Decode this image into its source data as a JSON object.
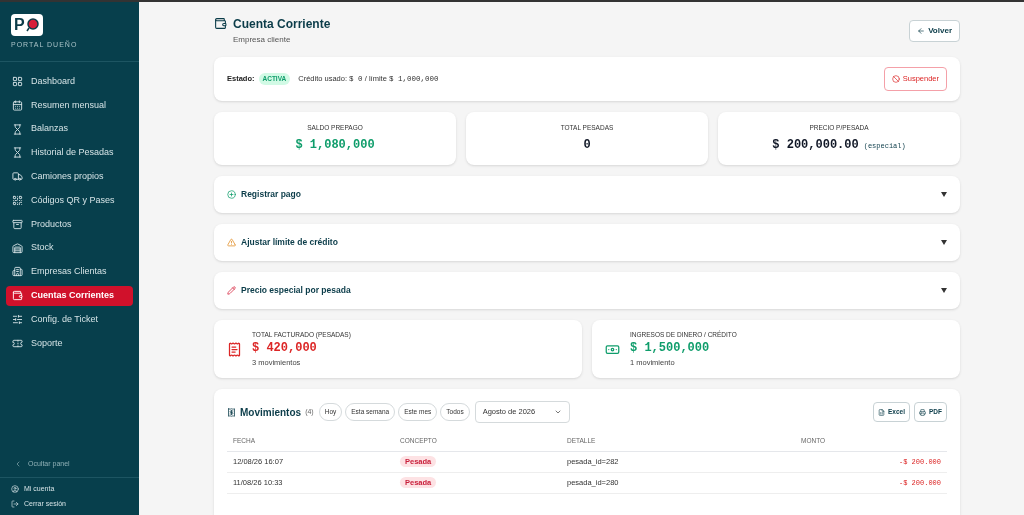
{
  "sidebar": {
    "logo_mark": "P",
    "logo_caption": "PORTAL DUEÑO",
    "items": [
      {
        "label": "Dashboard",
        "selected": false
      },
      {
        "label": "Resumen mensual",
        "selected": false
      },
      {
        "label": "Balanzas",
        "selected": false
      },
      {
        "label": "Historial de Pesadas",
        "selected": false
      },
      {
        "label": "Camiones propios",
        "selected": false
      },
      {
        "label": "Códigos QR y Pases",
        "selected": false
      },
      {
        "label": "Productos",
        "selected": false
      },
      {
        "label": "Stock",
        "selected": false
      },
      {
        "label": "Empresas Clientas",
        "selected": false
      },
      {
        "label": "Cuentas Corrientes",
        "selected": true
      },
      {
        "label": "Config. de Ticket",
        "selected": false
      },
      {
        "label": "Soporte",
        "selected": false
      }
    ],
    "collapse": "Ocultar panel",
    "account": "Mi cuenta",
    "logout": "Cerrar sesión"
  },
  "header": {
    "title": "Cuenta Corriente",
    "subtitle": "Empresa cliente",
    "back_button": "Volver"
  },
  "status": {
    "label": "Estado:",
    "badge": "ACTIVA",
    "credit_label": "Crédito usado:",
    "credit_used": "$ 0",
    "limit_label": "/ límite",
    "limit": "$ 1,000,000",
    "action": "Suspender"
  },
  "stats": [
    {
      "label": "SALDO PREPAGO",
      "value": "$ 1,080,000",
      "kind": "positive"
    },
    {
      "label": "TOTAL PESADAS",
      "value": "0",
      "kind": "neutral"
    },
    {
      "label": "PRECIO P/PESADA",
      "value": "$ 200,000.00",
      "note": "(especial)",
      "kind": "neutral"
    }
  ],
  "sections": [
    {
      "kind": "payment",
      "label": "Registrar pago",
      "expanded": false
    },
    {
      "kind": "warning",
      "label": "Ajustar límite de crédito",
      "expanded": false
    },
    {
      "kind": "edit",
      "label": "Precio especial por pesada",
      "expanded": false
    }
  ],
  "summaries": [
    {
      "kind": "billed",
      "label": "TOTAL FACTURADO (PESADAS)",
      "value": "$ 420,000",
      "caption": "3 movimientos"
    },
    {
      "kind": "income",
      "label": "INGRESOS DE DINERO / CRÉDITO",
      "value": "$ 1,500,000",
      "caption": "1 movimiento"
    }
  ],
  "movements": {
    "title": "Movimientos",
    "count": "(4)",
    "filters": [
      {
        "label": "Hoy",
        "selected": false
      },
      {
        "label": "Esta semana",
        "selected": false
      },
      {
        "label": "Este mes",
        "selected": false
      },
      {
        "label": "Todos",
        "selected": false
      }
    ],
    "period": "Agosto de 2026",
    "exports": [
      {
        "kind": "excel",
        "label": "Excel"
      },
      {
        "kind": "pdf",
        "label": "PDF"
      }
    ],
    "columns": [
      "FECHA",
      "CONCEPTO",
      "DETALLE",
      "MONTO"
    ],
    "rows": [
      {
        "date": "12/08/26 16:07",
        "concept": "Pesada",
        "detail": "pesada_id=282",
        "amount": "-$ 200.000"
      },
      {
        "date": "11/08/26 10:33",
        "concept": "Pesada",
        "detail": "pesada_id=280",
        "amount": "-$ 200.000"
      }
    ]
  }
}
